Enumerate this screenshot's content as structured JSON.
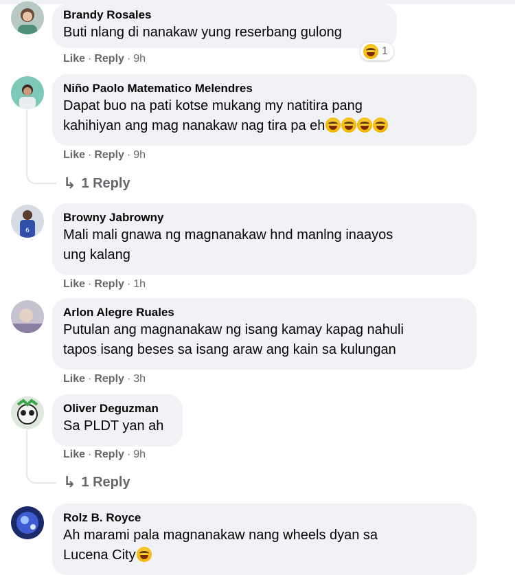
{
  "colors": {
    "bubble": "#f0f2f5",
    "meta": "#65676b",
    "text": "#050505"
  },
  "action_labels": {
    "like": "Like",
    "reply": "Reply",
    "dot": "·"
  },
  "comments": [
    {
      "author": "Brandy Rosales",
      "text": "Buti nlang di nanakaw yung reserbang gulong",
      "time": "9h",
      "reaction": {
        "icon": "laughing-emoji-icon",
        "count": "1"
      }
    },
    {
      "author": "Niño Paolo Matematico Melendres",
      "line1": "Dapat buo na pati kotse mukang my natitira pang",
      "line2": "kahihiyan ang mag nanakaw nag tira pa eh",
      "emoji_icon": "laughing-emoji-icon",
      "time": "9h",
      "replies": "1 Reply"
    },
    {
      "author": "Browny Jabrowny",
      "line1": "Mali mali gnawa ng magnanakaw hnd manlng inaayos",
      "line2": "ung kalang",
      "time": "1h"
    },
    {
      "author": "Arlon Alegre Ruales",
      "line1": "Putulan ang magnanakaw ng isang kamay kapag nahuli",
      "line2": "tapos isang beses sa isang araw ang kain sa kulungan",
      "time": "3h"
    },
    {
      "author": "Oliver Deguzman",
      "text": "Sa PLDT yan ah",
      "time": "9h",
      "replies": "1 Reply"
    },
    {
      "author": "Rolz B. Royce",
      "line1": "Ah marami pala magnanakaw nang wheels dyan sa",
      "line2": "Lucena City",
      "emoji_icon": "smiling-emoji-icon"
    }
  ]
}
